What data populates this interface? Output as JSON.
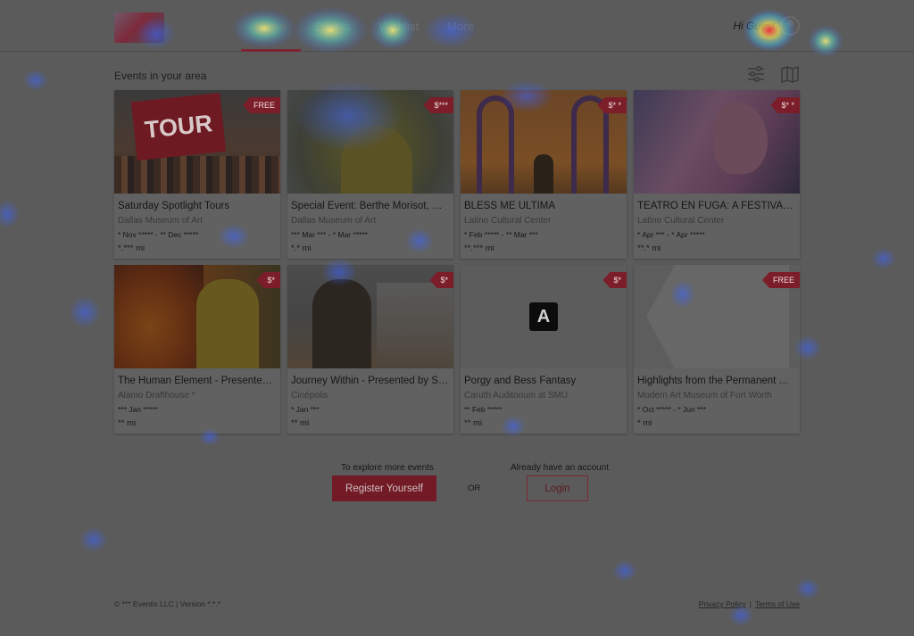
{
  "header": {
    "logo_text": "",
    "nav": [
      {
        "label": "Home",
        "active": true
      },
      {
        "label": "Events",
        "active": false
      },
      {
        "label": "Wishlist",
        "active": false
      },
      {
        "label": "More",
        "active": false
      }
    ],
    "greeting": "Hi Guest"
  },
  "section": {
    "title": "Events in your area"
  },
  "tools": {
    "filter_icon": "sliders-icon",
    "map_icon": "map-icon"
  },
  "events": [
    {
      "title": "Saturday Spotlight Tours",
      "venue": "Dallas Museum of Art",
      "dates": "* Nov ***** - ** Dec *****",
      "distance": "*.*** mi",
      "price": "FREE",
      "thumb_text": "TOUR"
    },
    {
      "title": "Special Event: Berthe Morisot, Wo...",
      "venue": "Dallas Museum of Art",
      "dates": "*** Mar *** - * Mar *****",
      "distance": "*.* mi",
      "price": "$***",
      "thumb_text": ""
    },
    {
      "title": "BLESS ME ULTIMA",
      "venue": "Latino Cultural Center",
      "dates": "* Feb ***** - ** Mar ***",
      "distance": "**.*** mi",
      "price": "$* *",
      "thumb_text": ""
    },
    {
      "title": "TEATRO EN FUGA: A FESTIVAL OF ...",
      "venue": "Latino Cultural Center",
      "dates": "* Apr *** - * Apr *****",
      "distance": "**.* mi",
      "price": "$* *",
      "thumb_text": ""
    },
    {
      "title": "The Human Element - Presented b...",
      "venue": "Alamo Drafthouse *",
      "dates": "*** Jan *****",
      "distance": "** mi",
      "price": "$*",
      "thumb_text": ""
    },
    {
      "title": "Journey Within - Presented by Sou...",
      "venue": "Cinépolis",
      "dates": "* Jan ***",
      "distance": "** mi",
      "price": "$*",
      "thumb_text": ""
    },
    {
      "title": "Porgy and Bess Fantasy",
      "venue": "Caruth Auditorium at SMU",
      "dates": "** Feb *****",
      "distance": "** mi",
      "price": "$*",
      "thumb_text": "A"
    },
    {
      "title": "Highlights from the Permanent Co...",
      "venue": "Modern Art Museum of Fort Worth",
      "dates": "* Oct ***** - * Jun ***",
      "distance": "* mi",
      "price": "FREE",
      "thumb_text": ""
    }
  ],
  "cta": {
    "explore_caption": "To explore more events",
    "register_label": "Register Yourself",
    "or_label": "OR",
    "account_caption": "Already have an account",
    "login_label": "Login"
  },
  "footer": {
    "copyright": "© *** Eventix LLC  |  Version *.*.*",
    "privacy": "Privacy Policy",
    "separator": "|",
    "terms": "Terms of Use"
  },
  "colors": {
    "accent": "#7a2632",
    "page_bg": "#5b5b5b"
  }
}
